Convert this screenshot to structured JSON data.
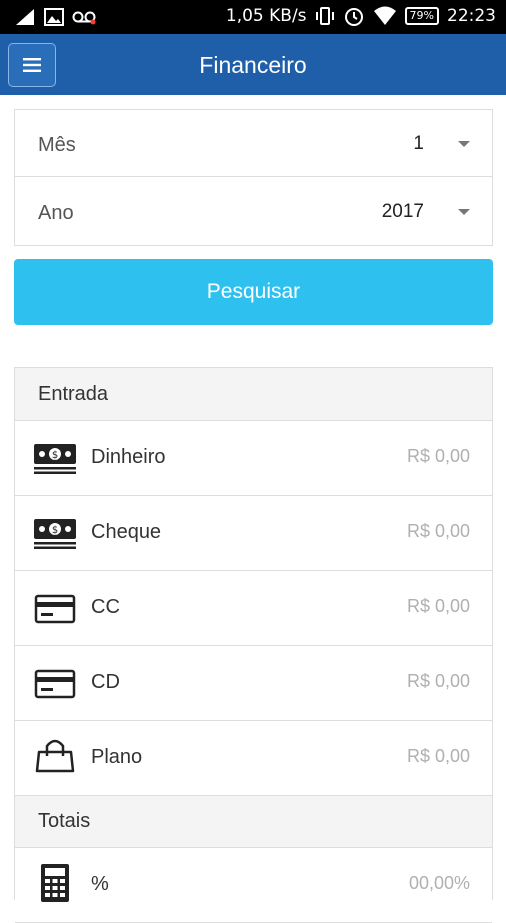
{
  "status_bar": {
    "speed": "1,05 KB/s",
    "battery": "79%",
    "time": "22:23",
    "icons": [
      "signal-icon",
      "image-icon",
      "voicemail-icon",
      "vibrate-icon",
      "alarm-icon",
      "wifi-icon",
      "battery-icon"
    ]
  },
  "appbar": {
    "title": "Financeiro",
    "menu_icon": "hamburger-menu-icon"
  },
  "filters": {
    "month": {
      "label": "Mês",
      "value": "1"
    },
    "year": {
      "label": "Ano",
      "value": "2017"
    }
  },
  "search_button": {
    "label": "Pesquisar"
  },
  "colors": {
    "appbar": "#1f5ea8",
    "button": "#2ec1ef",
    "value_text": "#b0b0b0"
  },
  "entrada": {
    "title": "Entrada",
    "rows": [
      {
        "label": "Dinheiro",
        "value": "R$ 0,00",
        "icon": "money-icon"
      },
      {
        "label": "Cheque",
        "value": "R$ 0,00",
        "icon": "money-icon"
      },
      {
        "label": "CC",
        "value": "R$ 0,00",
        "icon": "credit-card-icon"
      },
      {
        "label": "CD",
        "value": "R$ 0,00",
        "icon": "credit-card-icon"
      },
      {
        "label": "Plano",
        "value": "R$ 0,00",
        "icon": "shopping-bag-icon"
      }
    ]
  },
  "totais": {
    "title": "Totais",
    "rows": [
      {
        "label": "%",
        "value": "00,00%",
        "icon": "calculator-icon"
      }
    ]
  }
}
